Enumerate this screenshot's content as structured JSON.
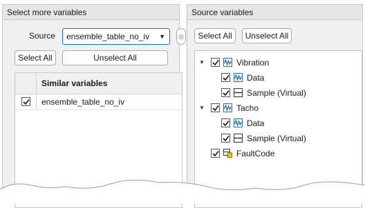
{
  "left_panel": {
    "title": "Select more variables",
    "source_label": "Source",
    "source_value": "ensemble_table_no_iv",
    "select_all": "Select All",
    "unselect_all": "Unselect All",
    "table": {
      "header": "Similar variables",
      "rows": [
        {
          "name": "ensemble_table_no_iv",
          "checked": true
        }
      ]
    }
  },
  "right_panel": {
    "title": "Source variables",
    "select_all": "Select All",
    "unselect_all": "Unselect All",
    "tree": [
      {
        "label": "Vibration",
        "checked": true,
        "expanded": true,
        "icon": "signal-icon",
        "children": [
          {
            "label": "Data",
            "checked": true,
            "icon": "signal-icon"
          },
          {
            "label": "Sample (Virtual)",
            "checked": true,
            "icon": "table-icon"
          }
        ]
      },
      {
        "label": "Tacho",
        "checked": true,
        "expanded": true,
        "icon": "signal-icon",
        "children": [
          {
            "label": "Data",
            "checked": true,
            "icon": "signal-icon"
          },
          {
            "label": "Sample (Virtual)",
            "checked": true,
            "icon": "table-icon"
          }
        ]
      },
      {
        "label": "FaultCode",
        "checked": true,
        "icon": "fault-code-icon"
      }
    ]
  }
}
